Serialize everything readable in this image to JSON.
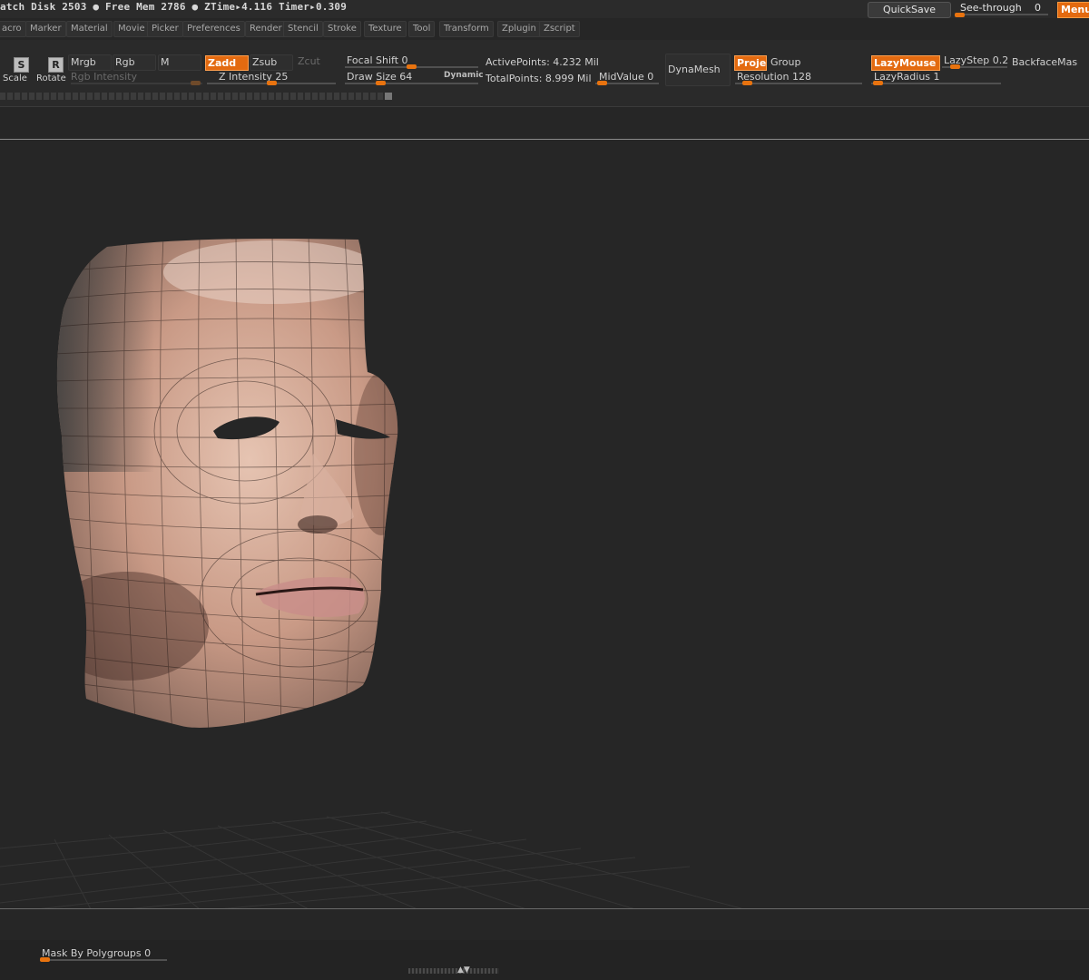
{
  "status_bar": {
    "text": "atch Disk 2503 ● Free Mem 2786 ● ZTime▸4.116 Timer▸0.309"
  },
  "top_right": {
    "quicksave_label": "QuickSave",
    "seethrough_label": "See-through",
    "seethrough_value": "0",
    "menus_label": "Menus"
  },
  "menu": {
    "items": [
      "acro",
      "Marker",
      "Material",
      "Movie",
      "Picker",
      "Preferences",
      "Render",
      "Stencil",
      "Stroke",
      "Texture",
      "Tool",
      "Transform",
      "Zplugin",
      "Zscript"
    ]
  },
  "toolbar": {
    "scale_label": "Scale",
    "scale_icon_letter": "S",
    "rotate_label": "Rotate",
    "rotate_icon_letter": "R",
    "mrgb": "Mrgb",
    "rgb": "Rgb",
    "m": "M",
    "rgb_intensity": "Rgb Intensity",
    "zadd": "Zadd",
    "zsub": "Zsub",
    "zcut": "Zcut",
    "z_intensity": "Z Intensity 25",
    "focal_shift": "Focal Shift 0",
    "draw_size": "Draw Size 64",
    "dynamic": "Dynamic",
    "active_points": "ActivePoints: 4.232  Mil",
    "total_points": "TotalPoints: 8.999  Mil",
    "mid_value": "MidValue 0",
    "dynamesh": "DynaMesh",
    "project": "Proje",
    "group": "Group",
    "resolution": "Resolution 128",
    "lazymouse": "LazyMouse",
    "lazystep": "LazyStep 0.2",
    "backface": "BackfaceMas",
    "lazyradius": "LazyRadius 1"
  },
  "bottom": {
    "mask_by_polygroups": "Mask By Polygroups 0"
  },
  "colors": {
    "accent": "#e36a10",
    "background": "#262626"
  },
  "icons": [
    "scale-icon",
    "rotate-icon",
    "head-model-render"
  ]
}
